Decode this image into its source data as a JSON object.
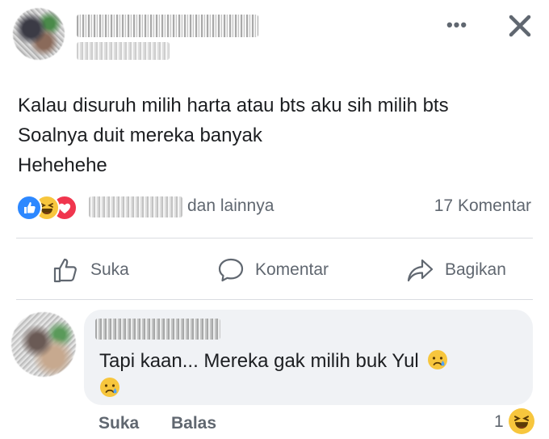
{
  "post": {
    "header": {
      "more_label": "•••"
    },
    "lines": [
      "Kalau disuruh milih harta atau bts aku sih milih bts",
      "Soalnya duit mereka banyak",
      "Hehehehe"
    ],
    "reactions": {
      "icons": [
        "like-icon",
        "haha-icon",
        "love-icon"
      ],
      "others_label": "dan lainnya",
      "comments_label": "17 Komentar"
    },
    "actions": {
      "like_label": "Suka",
      "comment_label": "Komentar",
      "share_label": "Bagikan"
    }
  },
  "comment": {
    "text": "Tapi kaan... Mereka gak milih buk Yul",
    "emoji": "sad-tear-emoji",
    "like_label": "Suka",
    "reply_label": "Balas",
    "reaction_count": "1",
    "reaction_icon": "haha-icon"
  },
  "colors": {
    "like_blue": "#2d88ff",
    "haha_yellow": "#f7c63d",
    "love_red": "#f0364e",
    "muted_text": "#606770",
    "bubble_bg": "#f0f2f5"
  }
}
